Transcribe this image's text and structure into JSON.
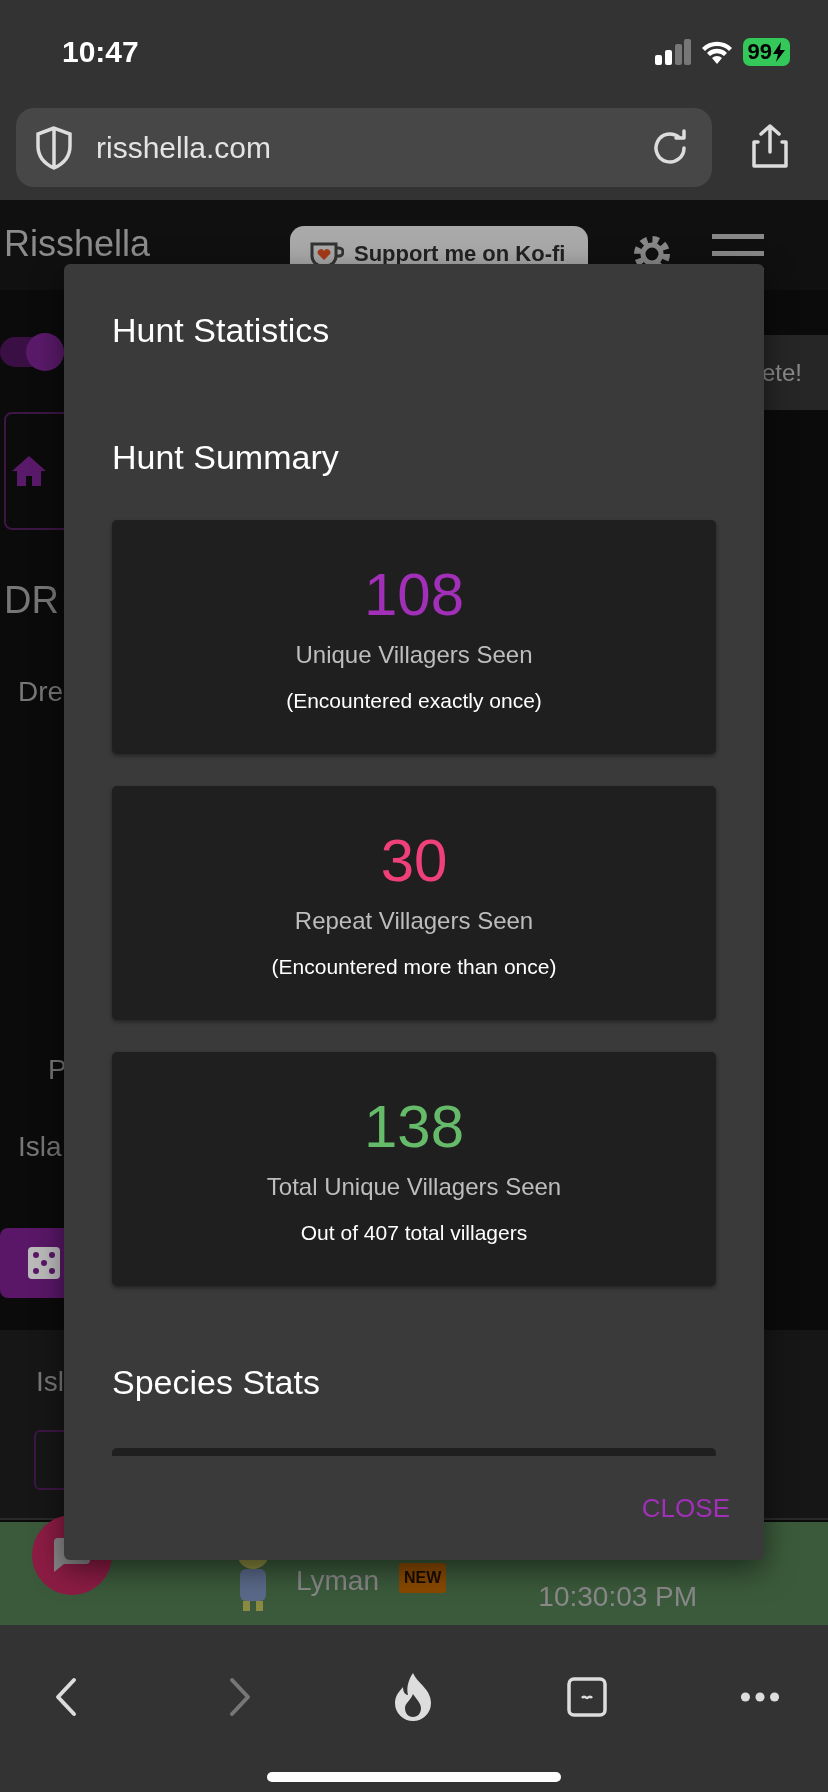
{
  "status_bar": {
    "time": "10:47",
    "battery": "99"
  },
  "browser": {
    "url": "risshella.com"
  },
  "page": {
    "site_title": "Risshella",
    "kofi_button": "Support me on Ko-fi",
    "toggle": {
      "on": true
    },
    "toast": "ete!",
    "heading": "DR",
    "labels": [
      "Dre",
      "P",
      "Isla"
    ],
    "tab_label": "Isl",
    "row": {
      "name": "Lyman",
      "badge": "NEW",
      "time": "10:30:03 PM"
    }
  },
  "dialog": {
    "title": "Hunt Statistics",
    "section": "Hunt Summary",
    "stats": [
      {
        "value": "108",
        "label": "Unique Villagers Seen",
        "note": "(Encountered exactly once)",
        "color": "#a12fb8"
      },
      {
        "value": "30",
        "label": "Repeat Villagers Seen",
        "note": "(Encountered more than once)",
        "color": "#f0407a"
      },
      {
        "value": "138",
        "label": "Total Unique Villagers Seen",
        "note": "Out of 407 total villagers",
        "color": "#66bb6a"
      }
    ],
    "next_section": "Species Stats",
    "close_button": "CLOSE"
  }
}
